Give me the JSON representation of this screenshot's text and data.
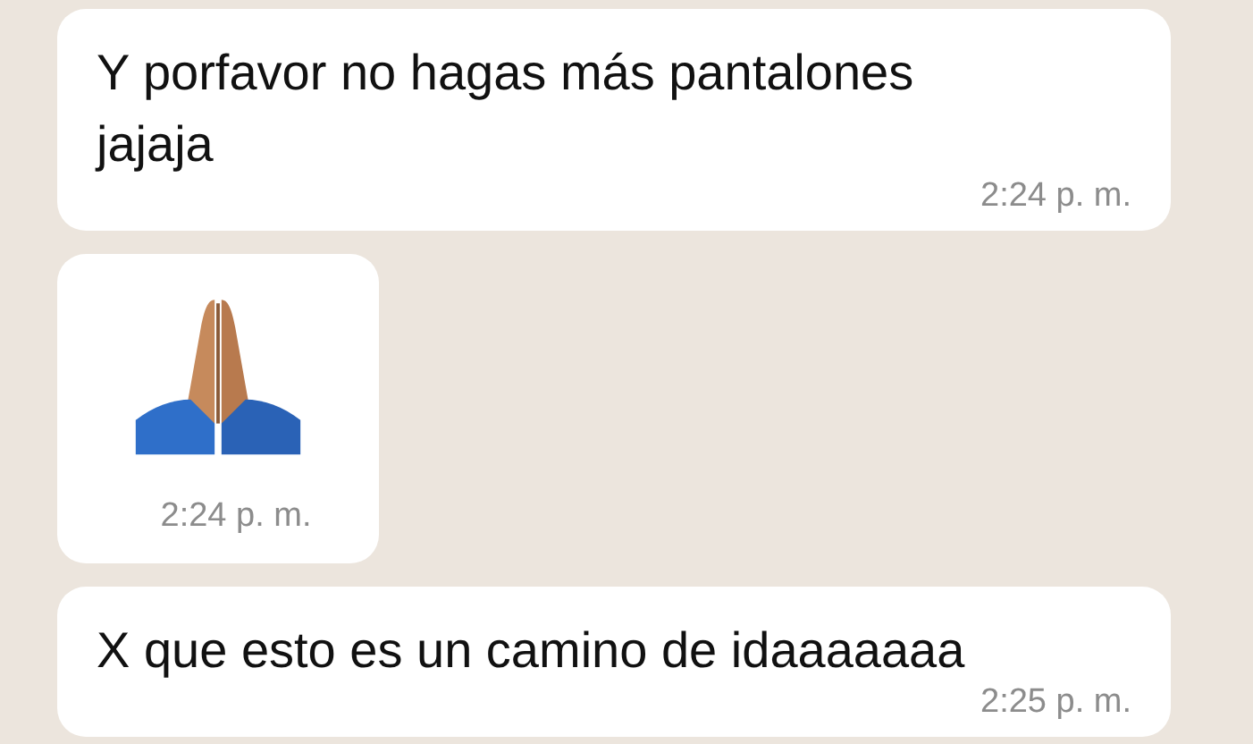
{
  "messages": [
    {
      "kind": "text",
      "text": "Y porfavor no hagas más pantalones jajaja",
      "time": "2:24 p. m."
    },
    {
      "kind": "emoji",
      "time": "2:24 p. m."
    },
    {
      "kind": "text",
      "text": "X que esto es un camino de idaaaaaaa",
      "time": "2:25 p. m."
    }
  ]
}
